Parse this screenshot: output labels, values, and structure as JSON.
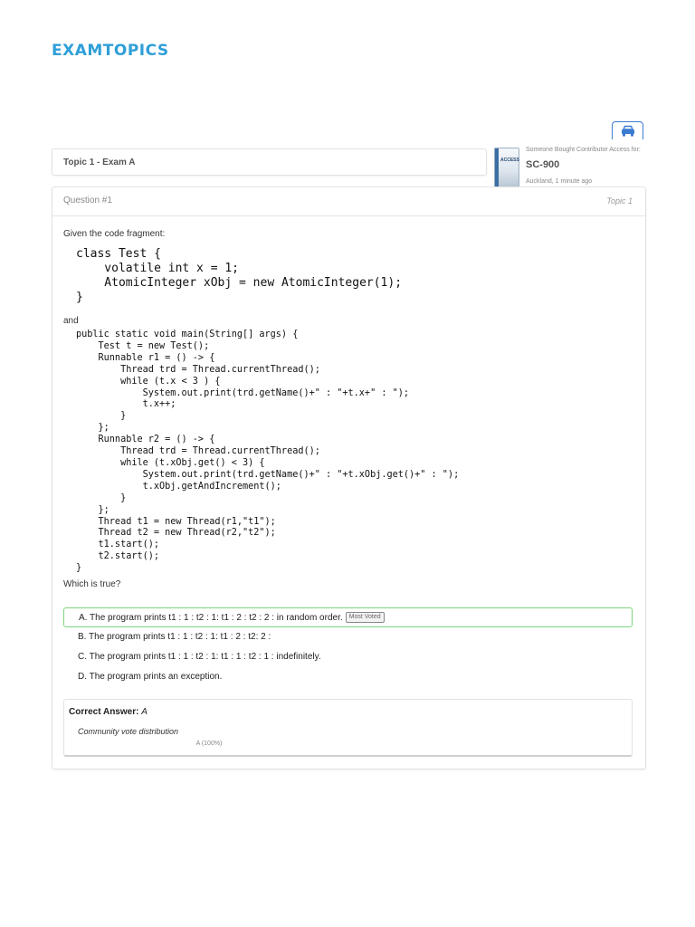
{
  "brand": {
    "logo_text": "EXAMTOPICS"
  },
  "topic": {
    "title": "Topic 1 - Exam A"
  },
  "promo": {
    "headline": "Someone Bought Contributor Access for:",
    "product": "SC-900",
    "location_time": "Auckland, 1 minute ago",
    "image_label": "ACCESS"
  },
  "question": {
    "number": "Question #1",
    "topic_tag": "Topic 1",
    "intro": "Given the code fragment:",
    "code_block_1": "class Test {\n    volatile int x = 1;\n    AtomicInteger xObj = new AtomicInteger(1);\n}",
    "connector": "and",
    "code_block_2": "public static void main(String[] args) {\n    Test t = new Test();\n    Runnable r1 = () -> {\n        Thread trd = Thread.currentThread();\n        while (t.x < 3 ) {\n            System.out.print(trd.getName()+\" : \"+t.x+\" : \");\n            t.x++;\n        }\n    };\n    Runnable r2 = () -> {\n        Thread trd = Thread.currentThread();\n        while (t.xObj.get() < 3) {\n            System.out.print(trd.getName()+\" : \"+t.xObj.get()+\" : \");\n            t.xObj.getAndIncrement();\n        }\n    };\n    Thread t1 = new Thread(r1,\"t1\");\n    Thread t2 = new Thread(r2,\"t2\");\n    t1.start();\n    t2.start();\n}",
    "prompt": "Which is true?",
    "choices": [
      {
        "text": "A. The program prints t1 : 1 : t2 : 1: t1 : 2 : t2 : 2 : in random order.",
        "badge": "Most Voted"
      },
      {
        "text": "B. The program prints t1 : 1 : t2 : 1: t1 : 2 : t2: 2 :"
      },
      {
        "text": "C. The program prints t1 : 1 : t2 : 1: t1 : 1 : t2 : 1 : indefinitely."
      },
      {
        "text": "D. The program prints an exception."
      }
    ],
    "correct_label": "Correct Answer:",
    "correct_value": "A",
    "vote_title": "Community vote distribution",
    "vote_result": "A (100%)"
  },
  "colors": {
    "brand": "#2f9fd9",
    "selected_border": "#7cd67c",
    "print_icon": "#3b7bd1"
  },
  "icons": {
    "print": "car-print-icon"
  }
}
